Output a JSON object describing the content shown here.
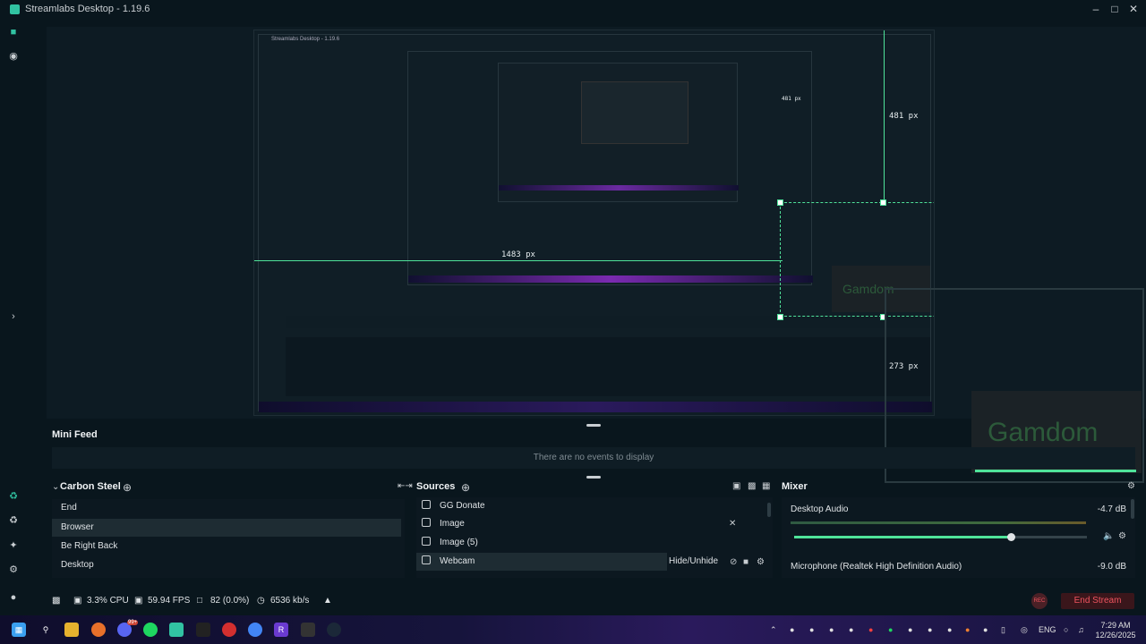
{
  "window": {
    "title": "Streamlabs Desktop - 1.19.6"
  },
  "preview": {
    "width_label": "1483 px",
    "height_label": "481 px",
    "height_label_nested": "481 px",
    "offset_label": "273 px",
    "nested_title": "Streamlabs Desktop - 1.19.6",
    "gamdom_text": "Gamdom"
  },
  "mini_feed": {
    "title": "Mini Feed",
    "empty_text": "There are no events to display"
  },
  "scenes": {
    "title": "Carbon Steel",
    "items": [
      {
        "label": "End"
      },
      {
        "label": "Browser"
      },
      {
        "label": "Be Right Back"
      },
      {
        "label": "Desktop"
      }
    ]
  },
  "sources": {
    "title": "Sources",
    "items": [
      {
        "label": "GG Donate"
      },
      {
        "label": "Image"
      },
      {
        "label": "Image (5)"
      },
      {
        "label": "Webcam"
      }
    ],
    "hover_tooltip": "Hide/Unhide"
  },
  "mixer": {
    "title": "Mixer",
    "channels": [
      {
        "name": "Desktop Audio",
        "db": "-4.7 dB",
        "level": 0.74
      },
      {
        "name": "Microphone (Realtek High Definition Audio)",
        "db": "-9.0 dB"
      }
    ]
  },
  "status": {
    "cpu": "3.3% CPU",
    "fps": "59.94 FPS",
    "dropped": "82 (0.0%)",
    "bitrate": "6536 kb/s",
    "rec_label": "REC",
    "end_stream": "End Stream"
  },
  "taskbar": {
    "lang": "ENG",
    "time": "7:29 AM",
    "date": "12/26/2025",
    "badge": "99+"
  },
  "colors": {
    "accent": "#4fe39a",
    "end_stream": "#f0545f",
    "bg": "#09161d"
  }
}
